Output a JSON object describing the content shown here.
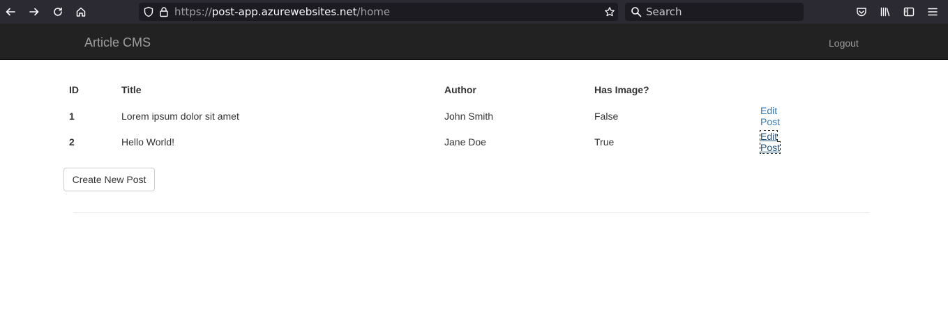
{
  "browser": {
    "url_scheme": "https://",
    "url_host": "post-app.azurewebsites.net",
    "url_path": "/home",
    "search_placeholder": "Search"
  },
  "navbar": {
    "brand": "Article CMS",
    "logout_label": "Logout"
  },
  "table": {
    "headers": {
      "id": "ID",
      "title": "Title",
      "author": "Author",
      "has_image": "Has Image?"
    },
    "rows": [
      {
        "id": "1",
        "title": "Lorem ipsum dolor sit amet",
        "author": "John Smith",
        "has_image": "False",
        "action": "Edit Post"
      },
      {
        "id": "2",
        "title": "Hello World!",
        "author": "Jane Doe",
        "has_image": "True",
        "action": "Edit Post"
      }
    ]
  },
  "create_button_label": "Create New Post",
  "colors": {
    "navbar_bg": "#222222",
    "link": "#337ab7",
    "browser_chrome": "#2b2a33"
  }
}
